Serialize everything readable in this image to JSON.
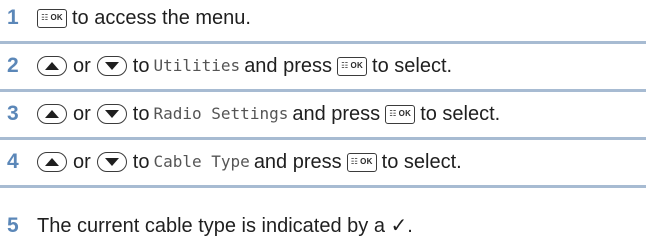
{
  "steps": [
    {
      "number": "1",
      "key_label": "OK",
      "text": "to access the menu."
    },
    {
      "number": "2",
      "or_text": "or",
      "to_text": "to",
      "menu_item": "Utilities",
      "and_press_text": "and press",
      "key_label": "OK",
      "to_select_text": "to select."
    },
    {
      "number": "3",
      "or_text": "or",
      "to_text": "to",
      "menu_item": "Radio Settings",
      "and_press_text": "and press",
      "key_label": "OK",
      "to_select_text": "to select."
    },
    {
      "number": "4",
      "or_text": "or",
      "to_text": "to",
      "menu_item": "Cable Type",
      "and_press_text": "and press",
      "key_label": "OK",
      "to_select_text": "to select."
    },
    {
      "number": "5",
      "text": "The current cable type is indicated by a ✓."
    }
  ],
  "icons": {
    "menu_ok_key": "menu-ok-key-icon",
    "up_key": "up-arrow-key-icon",
    "down_key": "down-arrow-key-icon"
  },
  "colors": {
    "step_number": "#5b87b8",
    "divider": "#a7bbd2",
    "text": "#1f1f1f",
    "menu_item_text": "#555555"
  }
}
